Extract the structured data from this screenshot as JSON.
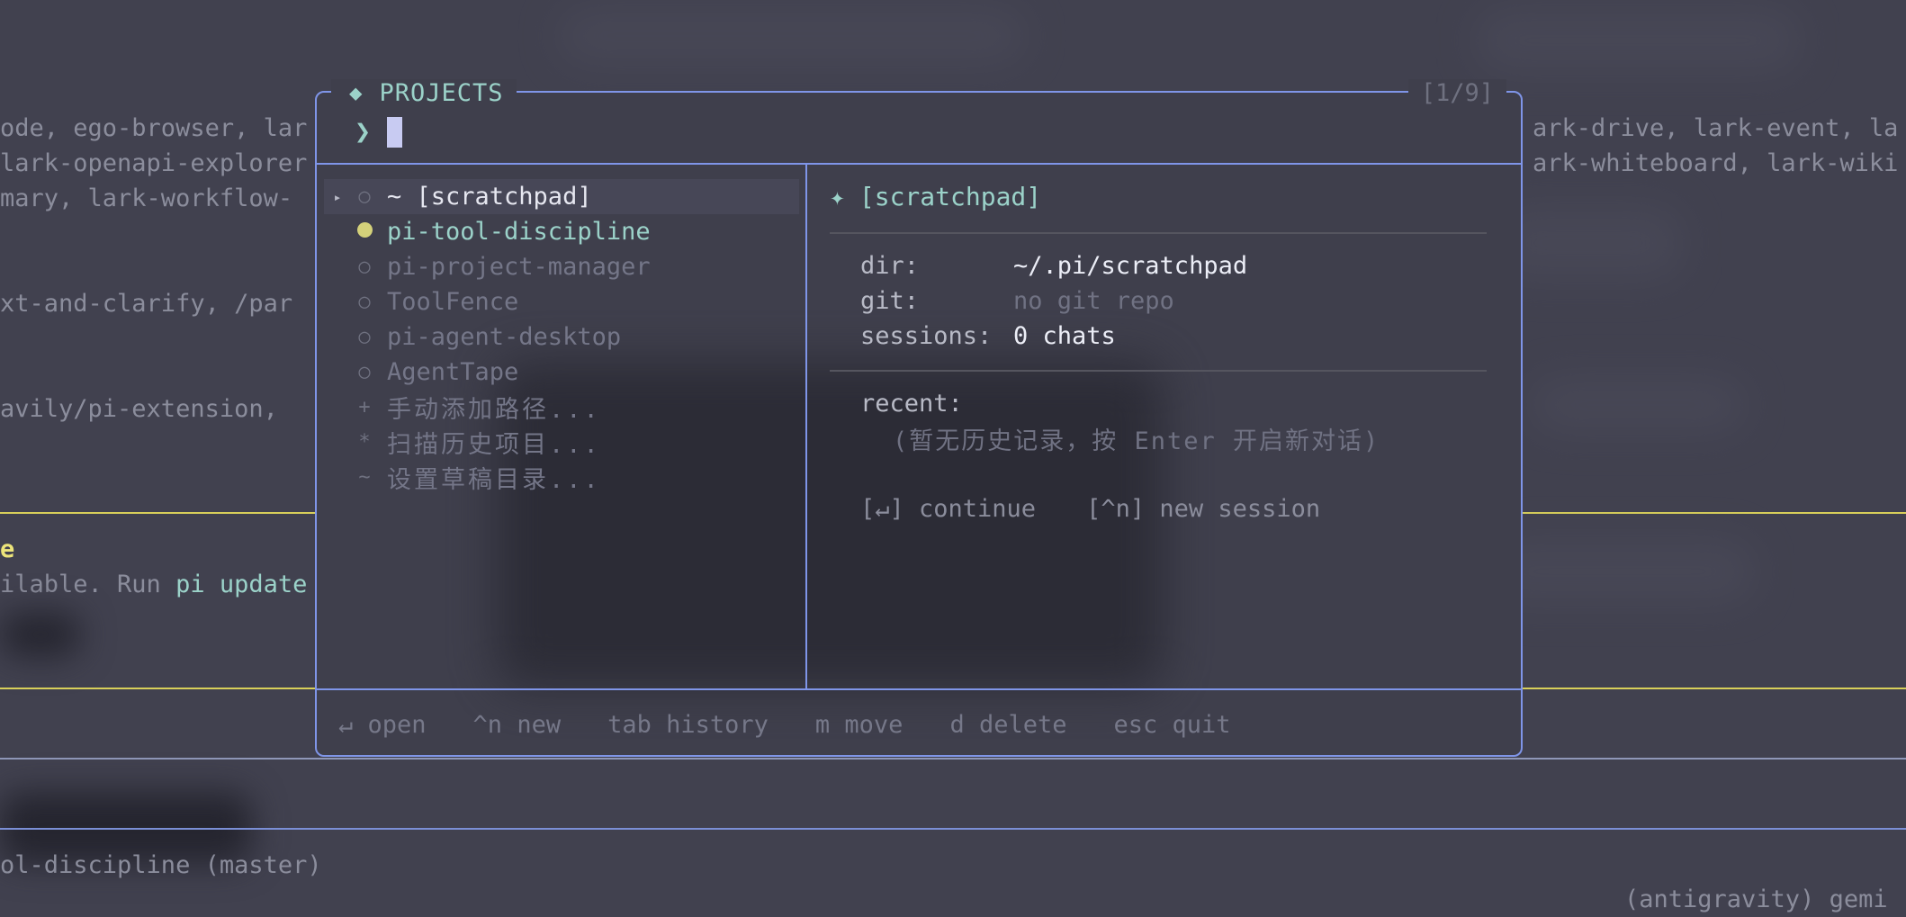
{
  "background": {
    "lines_left": [
      "ode, ego-browser, lar",
      "lark-openapi-explorer",
      "mary, lark-workflow-",
      "xt-and-clarify, /par",
      "avily/pi-extension,"
    ],
    "lines_right": [
      "ark-drive, lark-event, la",
      "ark-whiteboard, lark-wiki"
    ],
    "update_title": "e",
    "update_text_prefix": "ilable. Run ",
    "update_cmd": "pi update",
    "status_line": "ol-discipline (master)",
    "model_hint": "(antigravity) gemi"
  },
  "modal": {
    "title": "PROJECTS",
    "counter": "[1/9]",
    "prompt_symbol": "❯",
    "items": [
      {
        "label": "~ [scratchpad]"
      },
      {
        "label": "pi-tool-discipline"
      },
      {
        "label": "pi-project-manager"
      },
      {
        "label": "ToolFence"
      },
      {
        "label": "pi-agent-desktop"
      },
      {
        "label": "AgentTape"
      },
      {
        "label": "手动添加路径...",
        "mark": "+"
      },
      {
        "label": "扫描历史项目...",
        "mark": "*"
      },
      {
        "label": "设置草稿目录...",
        "mark": "~"
      }
    ],
    "detail": {
      "title": "[scratchpad]",
      "dir_label": "dir:",
      "dir_value": "~/.pi/scratchpad",
      "git_label": "git:",
      "git_value": "no git repo",
      "sessions_label": "sessions:",
      "sessions_value": "0 chats",
      "recent_label": "recent:",
      "recent_empty": "(暂无历史记录，按 Enter 开启新对话)",
      "continue_label": "[↵] continue",
      "new_session_label": "[^n] new session"
    },
    "footer": [
      "↵ open",
      "^n new",
      "tab history",
      "m move",
      "d delete",
      "esc quit"
    ]
  },
  "colors": {
    "accent": "#7f95e8",
    "cyan": "#9bd2c9",
    "yellow": "#d8cf5a"
  }
}
